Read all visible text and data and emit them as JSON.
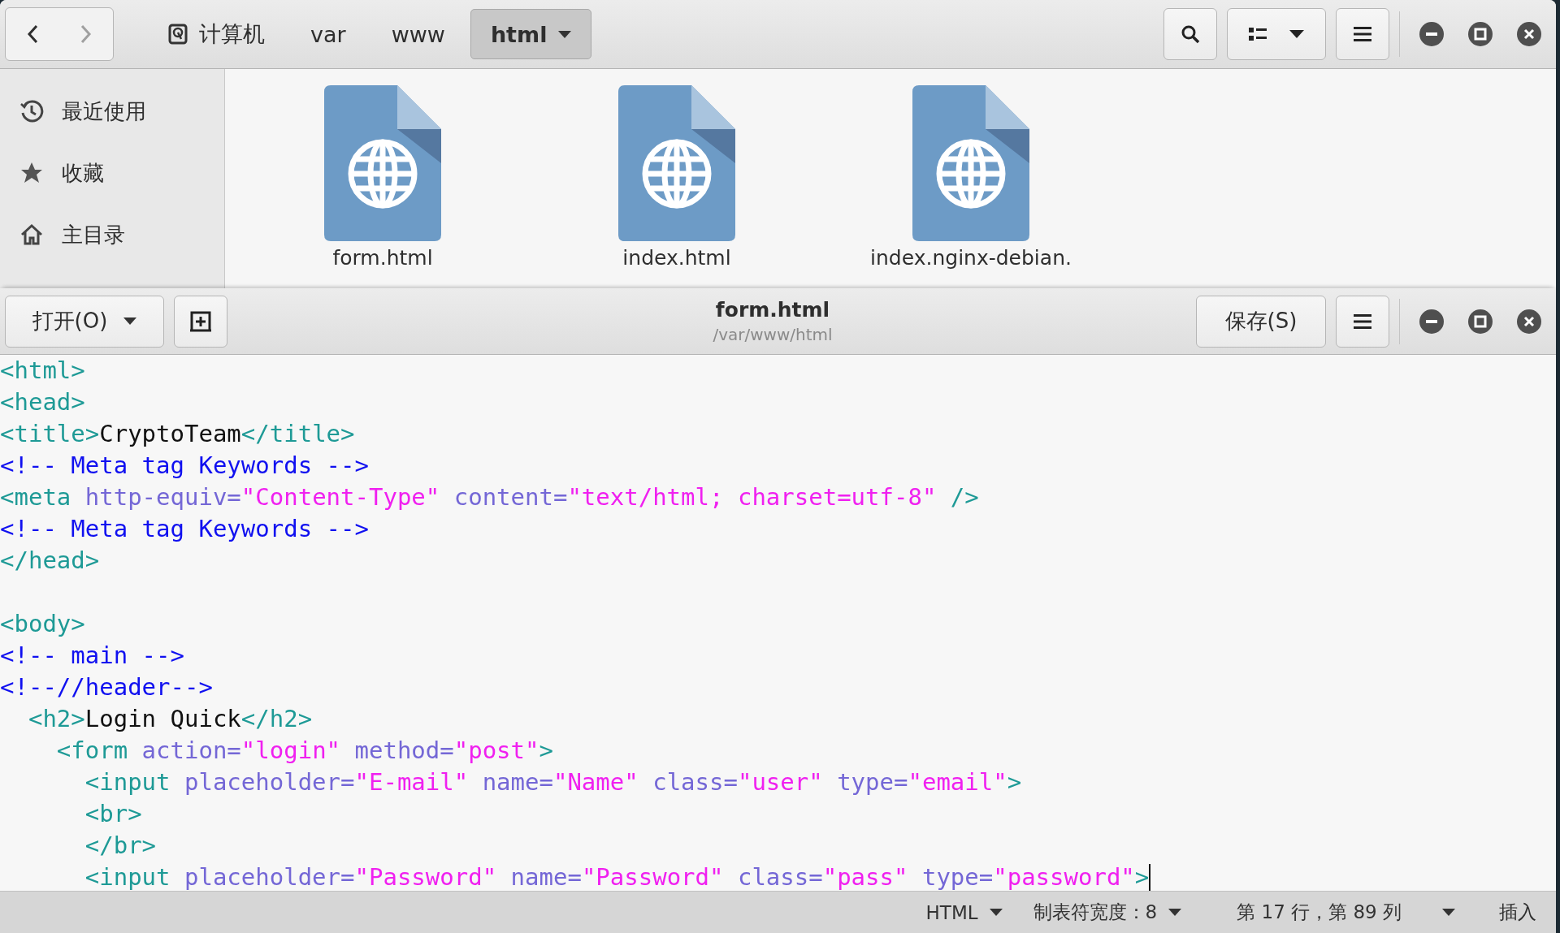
{
  "file_manager": {
    "nav_buttons": [
      {
        "kind": "back",
        "disabled": false
      },
      {
        "kind": "forward",
        "disabled": true
      }
    ],
    "breadcrumbs": [
      {
        "label": "计算机",
        "kind": "drive",
        "selected": false
      },
      {
        "label": "var",
        "kind": "folder",
        "selected": false
      },
      {
        "label": "www",
        "kind": "folder",
        "selected": false
      },
      {
        "label": "html",
        "kind": "folder",
        "selected": true
      }
    ],
    "sidebar": {
      "items": [
        {
          "label": "最近使用",
          "kind": "recent",
          "selected": false
        },
        {
          "label": "收藏",
          "kind": "starred",
          "selected": false
        },
        {
          "label": "主目录",
          "kind": "home",
          "selected": false
        }
      ]
    },
    "files": [
      {
        "name": "form.html"
      },
      {
        "name": "index.html"
      },
      {
        "name": "index.nginx-debian."
      }
    ]
  },
  "editor": {
    "open_button": "打开(O)",
    "title": "form.html",
    "subtitle": "/var/www/html",
    "save_button": "保存(S)",
    "lines": [
      {
        "kind": "code",
        "tokens": [
          {
            "kind": "tag",
            "text": "<html>"
          }
        ]
      },
      {
        "kind": "code",
        "tokens": [
          {
            "kind": "tag",
            "text": "<head>"
          }
        ]
      },
      {
        "kind": "code",
        "tokens": [
          {
            "kind": "tag",
            "text": "<title>"
          },
          {
            "kind": "text",
            "text": "CryptoTeam"
          },
          {
            "kind": "tag",
            "text": "</title>"
          }
        ]
      },
      {
        "kind": "code",
        "tokens": [
          {
            "kind": "comment",
            "text": "<!-- Meta tag Keywords -->"
          }
        ]
      },
      {
        "kind": "code",
        "tokens": [
          {
            "kind": "tag",
            "text": "<meta"
          },
          {
            "kind": "attr",
            "text": " http-equiv="
          },
          {
            "kind": "string",
            "text": "\"Content-Type\""
          },
          {
            "kind": "attr",
            "text": " content="
          },
          {
            "kind": "string",
            "text": "\"text/html; charset=utf-8\""
          },
          {
            "kind": "tag",
            "text": " />"
          }
        ]
      },
      {
        "kind": "code",
        "tokens": [
          {
            "kind": "comment",
            "text": "<!-- Meta tag Keywords -->"
          }
        ]
      },
      {
        "kind": "code",
        "tokens": [
          {
            "kind": "tag",
            "text": "</head>"
          }
        ]
      },
      {
        "kind": "blank"
      },
      {
        "kind": "code",
        "tokens": [
          {
            "kind": "tag",
            "text": "<body>"
          }
        ]
      },
      {
        "kind": "code",
        "tokens": [
          {
            "kind": "comment",
            "text": "<!-- main -->"
          }
        ]
      },
      {
        "kind": "code",
        "tokens": [
          {
            "kind": "comment",
            "text": "<!--//header-->"
          }
        ]
      },
      {
        "kind": "code",
        "tokens": [
          {
            "kind": "tag",
            "text": "  <h2>"
          },
          {
            "kind": "text",
            "text": "Login Quick"
          },
          {
            "kind": "tag",
            "text": "</h2>"
          }
        ]
      },
      {
        "kind": "code",
        "tokens": [
          {
            "kind": "tag",
            "text": "    <form"
          },
          {
            "kind": "attr",
            "text": " action="
          },
          {
            "kind": "string",
            "text": "\"login\""
          },
          {
            "kind": "attr",
            "text": " method="
          },
          {
            "kind": "string",
            "text": "\"post\""
          },
          {
            "kind": "tag",
            "text": ">"
          }
        ]
      },
      {
        "kind": "code",
        "tokens": [
          {
            "kind": "tag",
            "text": "      <input"
          },
          {
            "kind": "attr",
            "text": " placeholder="
          },
          {
            "kind": "string",
            "text": "\"E-mail\""
          },
          {
            "kind": "attr",
            "text": " name="
          },
          {
            "kind": "string",
            "text": "\"Name\""
          },
          {
            "kind": "attr",
            "text": " class="
          },
          {
            "kind": "string",
            "text": "\"user\""
          },
          {
            "kind": "attr",
            "text": " type="
          },
          {
            "kind": "string",
            "text": "\"email\""
          },
          {
            "kind": "tag",
            "text": ">"
          }
        ]
      },
      {
        "kind": "code",
        "tokens": [
          {
            "kind": "tag",
            "text": "      <br>"
          }
        ]
      },
      {
        "kind": "code",
        "tokens": [
          {
            "kind": "tag",
            "text": "      </br>"
          }
        ]
      },
      {
        "kind": "code",
        "cursor": true,
        "tokens": [
          {
            "kind": "tag",
            "text": "      <input"
          },
          {
            "kind": "attr",
            "text": " placeholder="
          },
          {
            "kind": "string",
            "text": "\"Password\""
          },
          {
            "kind": "attr",
            "text": " name="
          },
          {
            "kind": "string",
            "text": "\"Password\""
          },
          {
            "kind": "attr",
            "text": " class="
          },
          {
            "kind": "string",
            "text": "\"pass\""
          },
          {
            "kind": "attr",
            "text": " type="
          },
          {
            "kind": "string",
            "text": "\"password\""
          },
          {
            "kind": "tag",
            "text": ">"
          }
        ]
      }
    ],
    "status_bar": {
      "language": "HTML",
      "tab_width": "制表符宽度：8",
      "position": "第 17 行，第 89 列",
      "mode": "插入"
    }
  }
}
